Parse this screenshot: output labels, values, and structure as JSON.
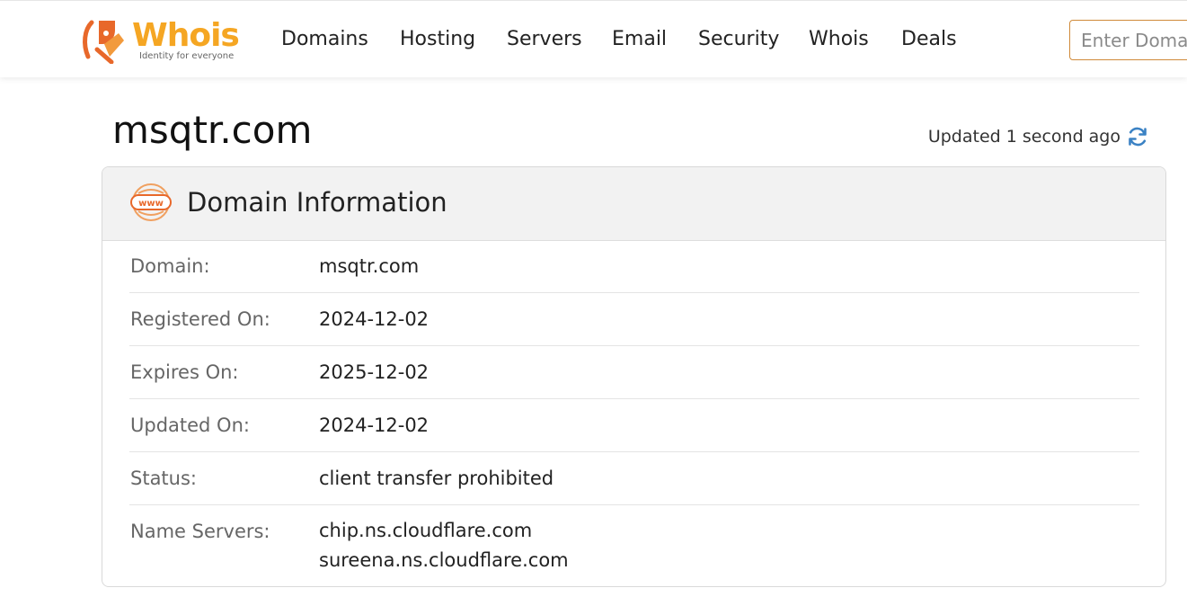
{
  "brand": {
    "name": "Whois",
    "tagline": "Identity for everyone",
    "accent_color": "#f5a623",
    "mark_color": "#e8682a"
  },
  "nav": {
    "items": [
      {
        "label": "Domains"
      },
      {
        "label": "Hosting"
      },
      {
        "label": "Servers"
      },
      {
        "label": "Email"
      },
      {
        "label": "Security"
      },
      {
        "label": "Whois"
      },
      {
        "label": "Deals"
      }
    ],
    "search_placeholder": "Enter Domain"
  },
  "page": {
    "title": "msqtr.com",
    "updated_text": "Updated 1 second ago",
    "refresh_icon": "refresh-icon"
  },
  "domain_info": {
    "title": "Domain Information",
    "icon": "www-icon",
    "rows": [
      {
        "label": "Domain:",
        "value": "msqtr.com"
      },
      {
        "label": "Registered On:",
        "value": "2024-12-02"
      },
      {
        "label": "Expires On:",
        "value": "2025-12-02"
      },
      {
        "label": "Updated On:",
        "value": "2024-12-02"
      },
      {
        "label": "Status:",
        "value": "client transfer prohibited"
      },
      {
        "label": "Name Servers:",
        "values": [
          "chip.ns.cloudflare.com",
          "sureena.ns.cloudflare.com"
        ]
      }
    ]
  }
}
